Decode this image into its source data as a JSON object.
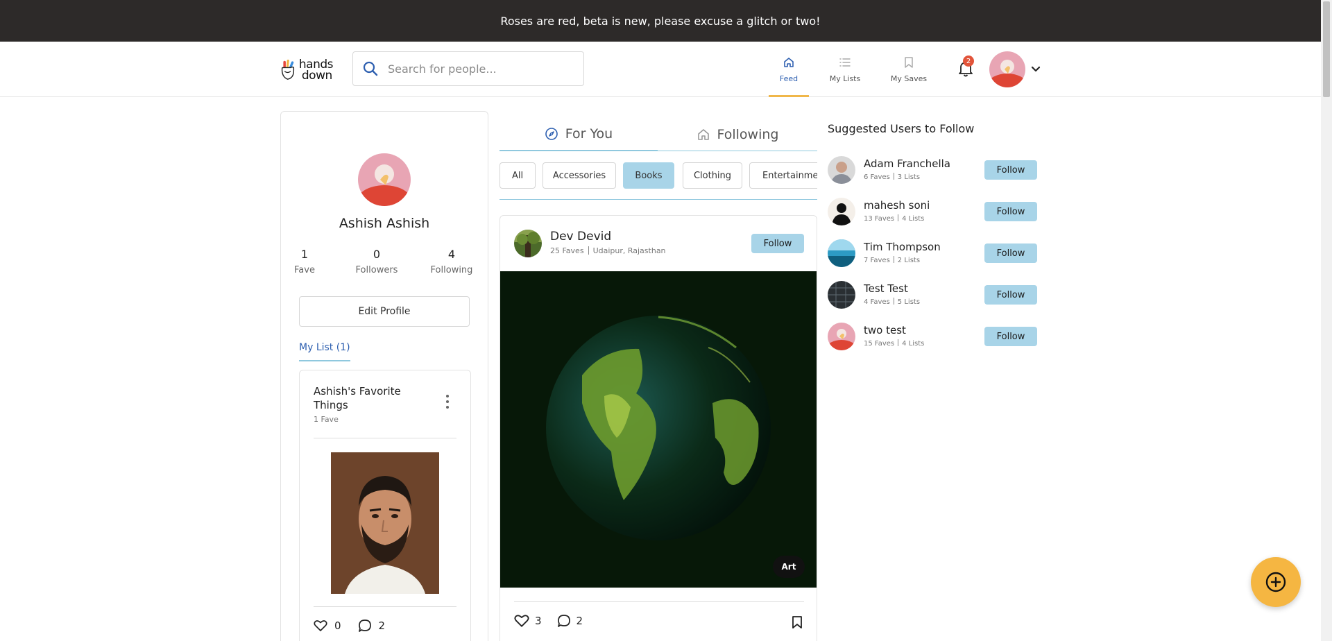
{
  "banner": {
    "text": "Roses are red, beta is new, please excuse a glitch or two!"
  },
  "header": {
    "logo_text_line1": "hands",
    "logo_text_line2": "down",
    "search_placeholder": "Search for people...",
    "nav": [
      {
        "label": "Feed",
        "icon": "home-icon",
        "active": true
      },
      {
        "label": "My Lists",
        "icon": "list-icon",
        "active": false
      },
      {
        "label": "My Saves",
        "icon": "bookmark-icon",
        "active": false
      }
    ],
    "notifications_count": "2"
  },
  "profile": {
    "name": "Ashish Ashish",
    "stats": [
      {
        "value": "1",
        "label": "Fave"
      },
      {
        "value": "0",
        "label": "Followers"
      },
      {
        "value": "4",
        "label": "Following"
      }
    ],
    "edit_label": "Edit Profile",
    "my_list_tab": "My List (1)",
    "list": {
      "title": "Ashish's Favorite Things",
      "subtitle": "1 Fave",
      "likes": "0",
      "comments": "2"
    }
  },
  "feed": {
    "tabs": [
      {
        "label": "For You",
        "icon": "compass-icon",
        "active": true
      },
      {
        "label": "Following",
        "icon": "home-outline-icon",
        "active": false
      }
    ],
    "chips": [
      {
        "label": "All",
        "active": false
      },
      {
        "label": "Accessories",
        "active": false
      },
      {
        "label": "Books",
        "active": true
      },
      {
        "label": "Clothing",
        "active": false
      },
      {
        "label": "Entertainment",
        "active": false
      }
    ],
    "post": {
      "author": "Dev Devid",
      "faves": "25 Faves",
      "location": "Udaipur, Rajasthan",
      "follow_label": "Follow",
      "tag": "Art",
      "likes": "3",
      "comments": "2"
    }
  },
  "suggested": {
    "title": "Suggested Users to Follow",
    "follow_label": "Follow",
    "users": [
      {
        "name": "Adam Franchella",
        "faves": "6 Faves",
        "lists": "3 Lists"
      },
      {
        "name": "mahesh soni",
        "faves": "13 Faves",
        "lists": "4 Lists"
      },
      {
        "name": "Tim Thompson",
        "faves": "7 Faves",
        "lists": "2 Lists"
      },
      {
        "name": "Test Test",
        "faves": "4 Faves",
        "lists": "5 Lists"
      },
      {
        "name": "two test",
        "faves": "15 Faves",
        "lists": "4 Lists"
      }
    ]
  },
  "colors": {
    "banner_bg": "#2d2a29",
    "accent_blue": "#a8d4e8",
    "active_nav": "#2d5fb0",
    "fab": "#f5b642",
    "badge": "#e2543a"
  }
}
